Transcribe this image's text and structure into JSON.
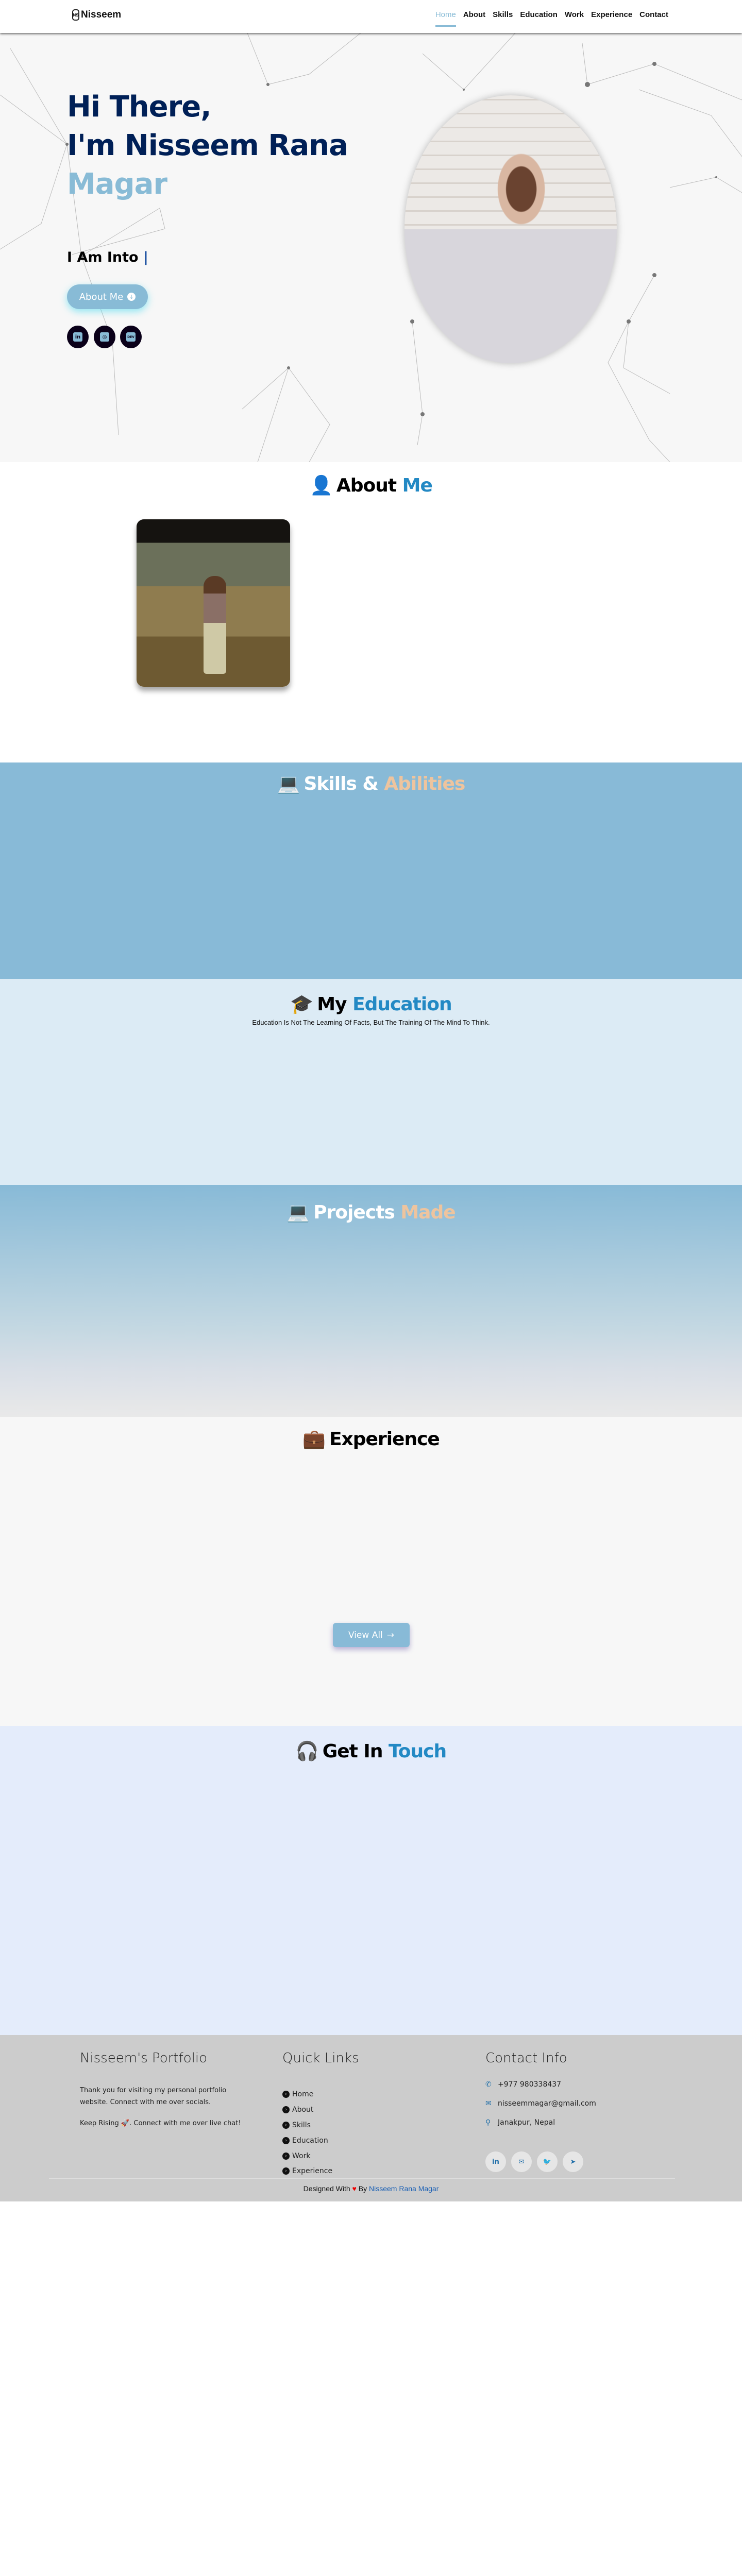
{
  "nav": {
    "brand": "Nisseem",
    "brand_mark": "NS",
    "items": [
      {
        "label": "Home",
        "active": true
      },
      {
        "label": "About"
      },
      {
        "label": "Skills"
      },
      {
        "label": "Education"
      },
      {
        "label": "Work"
      },
      {
        "label": "Experience"
      },
      {
        "label": "Contact"
      }
    ]
  },
  "hero": {
    "line1": "Hi There,",
    "line2": "I'm Nisseem Rana",
    "line3": "Magar",
    "typing_prefix": "I Am Into",
    "cursor": "|",
    "button_label": "About Me",
    "socials": [
      {
        "icon": "linkedin-icon",
        "glyph": "in"
      },
      {
        "icon": "instagram-icon",
        "glyph": "◎"
      },
      {
        "icon": "dev-icon",
        "glyph": "DEV"
      }
    ]
  },
  "about": {
    "title": "About",
    "title_highlight": "Me"
  },
  "skills": {
    "title": "Skills &",
    "title_highlight": "Abilities"
  },
  "education": {
    "title": "My",
    "title_highlight": "Education",
    "subtitle": "Education Is Not The Learning Of Facts, But The Training Of The Mind To Think."
  },
  "projects": {
    "title": "Projects",
    "title_highlight": "Made"
  },
  "experience": {
    "title": "Experience",
    "view_all": "View All"
  },
  "contact": {
    "title": "Get In",
    "title_highlight": "Touch"
  },
  "footer": {
    "about_title": "Nisseem's Portfolio",
    "about_text1": "Thank you for visiting my personal portfolio website. Connect with me over socials.",
    "about_text2": "Keep Rising 🚀. Connect with me over live chat!",
    "links_title": "Quick Links",
    "links": [
      "Home",
      "About",
      "Skills",
      "Education",
      "Work",
      "Experience"
    ],
    "contact_title": "Contact Info",
    "phone": "+977 980338437",
    "email": "nisseemmagar@gmail.com",
    "location": "Janakpur, Nepal",
    "socials": [
      {
        "icon": "linkedin-icon",
        "glyph": "in"
      },
      {
        "icon": "mail-icon",
        "glyph": "✉"
      },
      {
        "icon": "twitter-icon",
        "glyph": "🐦"
      },
      {
        "icon": "telegram-icon",
        "glyph": "➤"
      }
    ],
    "credit_prefix": "Designed With",
    "credit_by": "By",
    "credit_name": "Nisseem Rana Magar"
  },
  "colors": {
    "accent": "#88bbd6",
    "navy": "#002057",
    "blue": "#2389c4",
    "peach": "#eec49e"
  }
}
